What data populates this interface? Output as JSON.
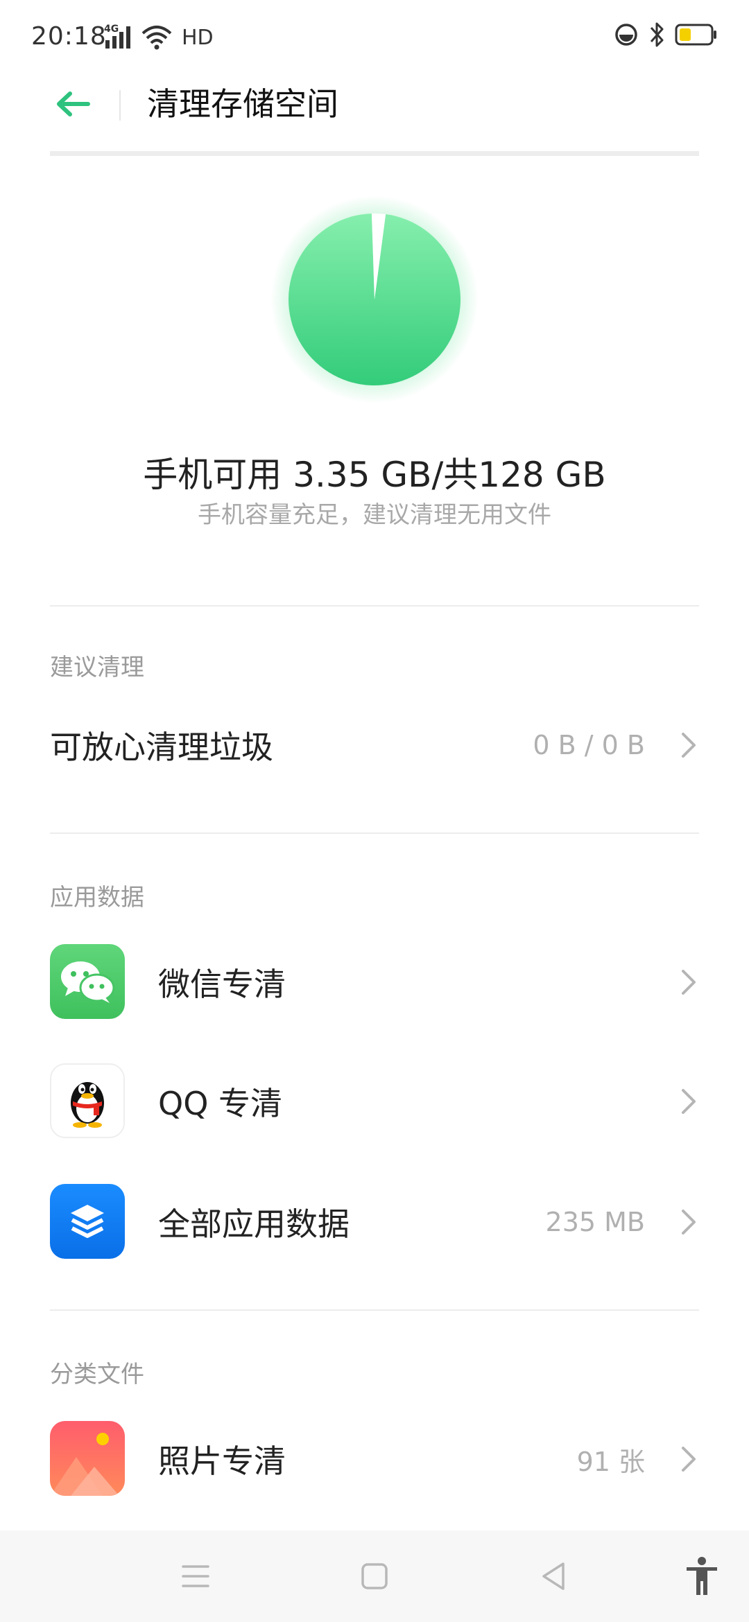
{
  "status_bar": {
    "time": "20:18",
    "network": "4G",
    "hd": "HD",
    "battery_color": "#f5d000"
  },
  "header": {
    "title": "清理存储空间",
    "accent_color": "#2ec27e"
  },
  "storage": {
    "used_fraction": 0.974,
    "summary": "手机可用 3.35 GB/共128 GB",
    "hint": "手机容量充足，建议清理无用文件"
  },
  "sections": {
    "suggest": {
      "title": "建议清理",
      "junk_label": "可放心清理垃圾",
      "junk_value": "0 B / 0 B"
    },
    "app_data": {
      "title": "应用数据",
      "items": [
        {
          "label": "微信专清",
          "value": "",
          "icon": "wechat-icon"
        },
        {
          "label": "QQ 专清",
          "value": "",
          "icon": "qq-penguin-icon"
        },
        {
          "label": "全部应用数据",
          "value": "235 MB",
          "icon": "layers-icon"
        }
      ]
    },
    "files": {
      "title": "分类文件",
      "items": [
        {
          "label": "照片专清",
          "value": "91 张",
          "icon": "photos-icon"
        }
      ]
    }
  }
}
